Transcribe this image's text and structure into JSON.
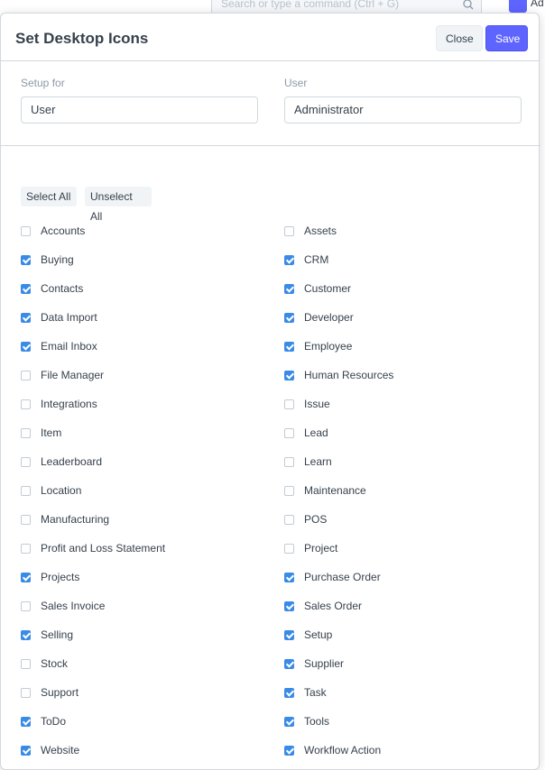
{
  "background": {
    "search_placeholder": "Search or type a command (Ctrl + G)",
    "avatar_text": "Ad"
  },
  "modal": {
    "title": "Set Desktop Icons",
    "close_label": "Close",
    "save_label": "Save",
    "setup_for_label": "Setup for",
    "setup_for_value": "User",
    "user_label": "User",
    "user_value": "Administrator",
    "select_all_label": "Select All",
    "unselect_all_label": "Unselect All"
  },
  "colors": {
    "primary": "#5e64ff",
    "checkbox": "#3a8be6"
  },
  "left_options": [
    {
      "label": "Accounts",
      "checked": false
    },
    {
      "label": "Buying",
      "checked": true
    },
    {
      "label": "Contacts",
      "checked": true
    },
    {
      "label": "Data Import",
      "checked": true
    },
    {
      "label": "Email Inbox",
      "checked": true
    },
    {
      "label": "File Manager",
      "checked": false
    },
    {
      "label": "Integrations",
      "checked": false
    },
    {
      "label": "Item",
      "checked": false
    },
    {
      "label": "Leaderboard",
      "checked": false
    },
    {
      "label": "Location",
      "checked": false
    },
    {
      "label": "Manufacturing",
      "checked": false
    },
    {
      "label": "Profit and Loss Statement",
      "checked": false
    },
    {
      "label": "Projects",
      "checked": true
    },
    {
      "label": "Sales Invoice",
      "checked": false
    },
    {
      "label": "Selling",
      "checked": true
    },
    {
      "label": "Stock",
      "checked": false
    },
    {
      "label": "Support",
      "checked": false
    },
    {
      "label": "ToDo",
      "checked": true
    },
    {
      "label": "Website",
      "checked": true
    }
  ],
  "right_options": [
    {
      "label": "Assets",
      "checked": false
    },
    {
      "label": "CRM",
      "checked": true
    },
    {
      "label": "Customer",
      "checked": true
    },
    {
      "label": "Developer",
      "checked": true
    },
    {
      "label": "Employee",
      "checked": true
    },
    {
      "label": "Human Resources",
      "checked": true
    },
    {
      "label": "Issue",
      "checked": false
    },
    {
      "label": "Lead",
      "checked": false
    },
    {
      "label": "Learn",
      "checked": false
    },
    {
      "label": "Maintenance",
      "checked": false
    },
    {
      "label": "POS",
      "checked": false
    },
    {
      "label": "Project",
      "checked": false
    },
    {
      "label": "Purchase Order",
      "checked": true
    },
    {
      "label": "Sales Order",
      "checked": true
    },
    {
      "label": "Setup",
      "checked": true
    },
    {
      "label": "Supplier",
      "checked": true
    },
    {
      "label": "Task",
      "checked": true
    },
    {
      "label": "Tools",
      "checked": true
    },
    {
      "label": "Workflow Action",
      "checked": true
    }
  ]
}
